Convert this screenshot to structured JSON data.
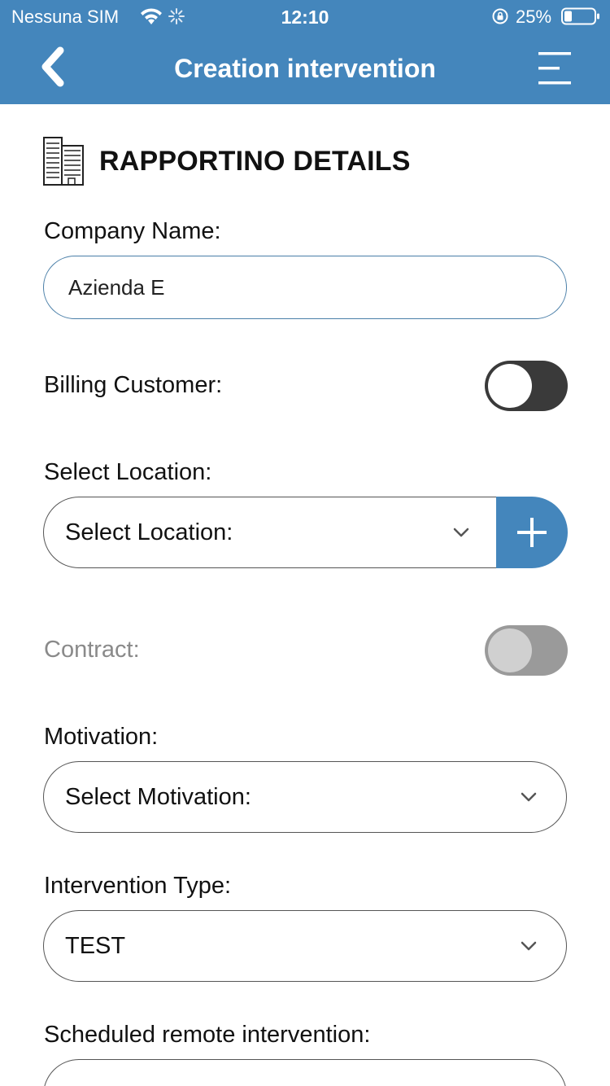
{
  "status_bar": {
    "carrier": "Nessuna SIM",
    "time": "12:10",
    "battery_percent": "25%",
    "icons": [
      "wifi-icon",
      "spinner-icon",
      "orientation-lock-icon",
      "battery-icon"
    ]
  },
  "header": {
    "title": "Creation intervention",
    "back_icon": "chevron-left-icon",
    "menu_icon": "menu-icon"
  },
  "section": {
    "title": "RAPPORTINO DETAILS",
    "icon": "building-icon"
  },
  "form": {
    "company_name_label": "Company Name:",
    "company_name_value": "Azienda E",
    "billing_customer_label": "Billing Customer:",
    "billing_customer_on": false,
    "select_location_label": "Select Location:",
    "select_location_value": "Select Location:",
    "contract_label": "Contract:",
    "contract_enabled": false,
    "motivation_label": "Motivation:",
    "motivation_value": "Select Motivation:",
    "intervention_type_label": "Intervention Type:",
    "intervention_type_value": "TEST",
    "scheduled_remote_label": "Scheduled remote intervention:"
  },
  "colors": {
    "brand_blue": "#4486BC",
    "toggle_dark": "#3a3a3a",
    "toggle_disabled": "#9a9a9a"
  }
}
